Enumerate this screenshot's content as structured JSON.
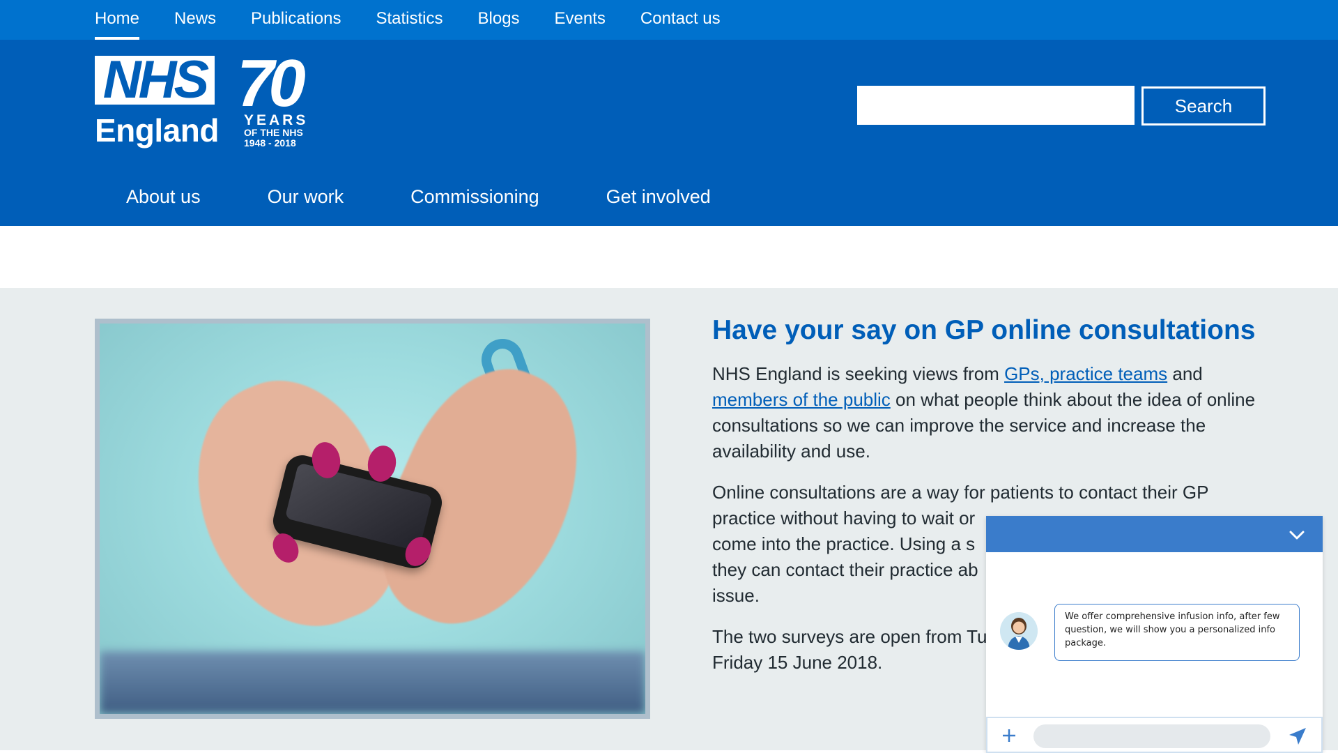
{
  "top_nav": [
    "Home",
    "News",
    "Publications",
    "Statistics",
    "Blogs",
    "Events",
    "Contact us"
  ],
  "logo": {
    "wordmark": "NHS",
    "region": "England"
  },
  "anniversary": {
    "number": "70",
    "years": "YEARS",
    "of_nhs": "OF THE NHS",
    "dates": "1948 - 2018"
  },
  "search": {
    "value": "",
    "button_label": "Search"
  },
  "main_nav": [
    "About us",
    "Our work",
    "Commissioning",
    "Get involved"
  ],
  "article": {
    "title": "Have your say on GP online consultations",
    "p1_before": "NHS England is seeking views from ",
    "p1_link1": "GPs, practice teams",
    "p1_mid": " and ",
    "p1_link2": "members of the public",
    "p1_after": " on what people think about the idea of online consultations so we can improve the service and increase the availability and use.",
    "p2": "Online consultations are a way for patients to contact their GP practice without having to wait or come into the practice. Using a s they can contact their practice ab issue.",
    "p2_visible_lines": [
      "Online consultations are a way for patients to contact their GP",
      "practice without having to wait or",
      "come into the practice. Using a s",
      "they can contact their practice ab",
      "issue."
    ],
    "p3_visible_lines": [
      "The two surveys are open from Tu",
      "Friday 15 June 2018."
    ]
  },
  "chat": {
    "message": "We offer comprehensive infusion info, after few question, we will show you a personalized info package.",
    "input_value": ""
  },
  "colors": {
    "topbar": "#0072ce",
    "header": "#005eb8",
    "band": "#e8edee",
    "chat_accent": "#3a7ccb"
  },
  "icons": [
    "chevron-down-icon",
    "avatar-icon",
    "plus-icon",
    "send-icon"
  ]
}
